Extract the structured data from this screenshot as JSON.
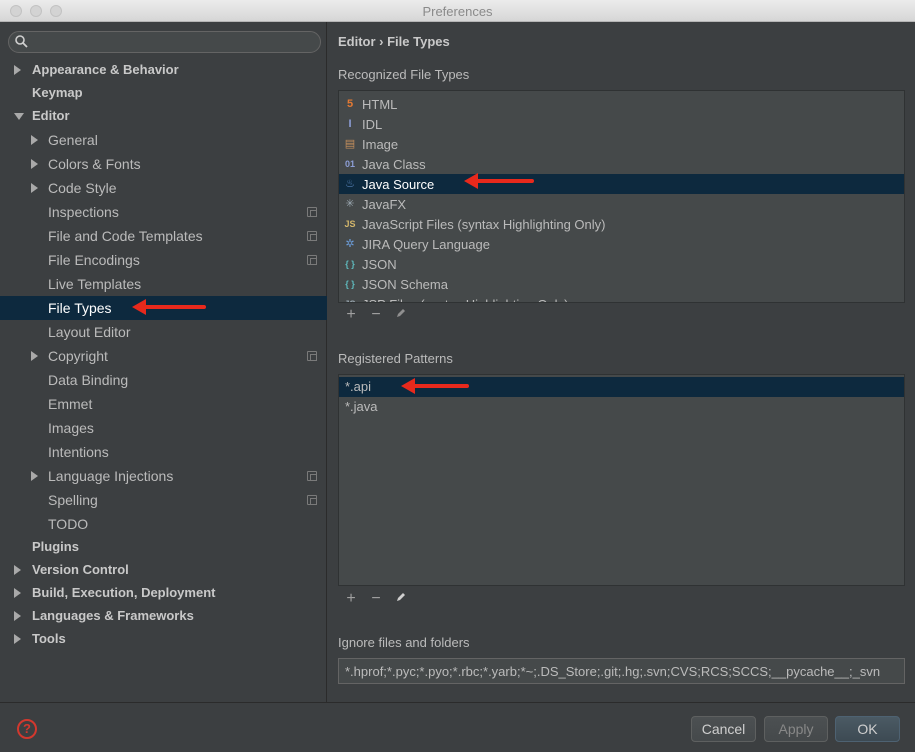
{
  "window": {
    "title": "Preferences"
  },
  "search": {
    "placeholder": ""
  },
  "sidebar": {
    "items": [
      {
        "label": "Appearance & Behavior",
        "arrow": "right",
        "bold": true
      },
      {
        "label": "Keymap",
        "arrow": "",
        "bold": true
      },
      {
        "label": "Editor",
        "arrow": "down",
        "bold": true
      },
      {
        "label": "General",
        "arrow": "right"
      },
      {
        "label": "Colors & Fonts",
        "arrow": "right"
      },
      {
        "label": "Code Style",
        "arrow": "right"
      },
      {
        "label": "Inspections",
        "copy": true
      },
      {
        "label": "File and Code Templates",
        "copy": true
      },
      {
        "label": "File Encodings",
        "copy": true
      },
      {
        "label": "Live Templates"
      },
      {
        "label": "File Types",
        "selected": true
      },
      {
        "label": "Layout Editor"
      },
      {
        "label": "Copyright",
        "arrow": "right",
        "copy": true
      },
      {
        "label": "Data Binding"
      },
      {
        "label": "Emmet"
      },
      {
        "label": "Images"
      },
      {
        "label": "Intentions"
      },
      {
        "label": "Language Injections",
        "arrow": "right",
        "copy": true
      },
      {
        "label": "Spelling",
        "copy": true
      },
      {
        "label": "TODO"
      },
      {
        "label": "Plugins",
        "bold": true
      },
      {
        "label": "Version Control",
        "arrow": "right",
        "bold": true
      },
      {
        "label": "Build, Execution, Deployment",
        "arrow": "right",
        "bold": true
      },
      {
        "label": "Languages & Frameworks",
        "arrow": "right",
        "bold": true
      },
      {
        "label": "Tools",
        "arrow": "right",
        "bold": true
      }
    ]
  },
  "main": {
    "breadcrumb": "Editor › File Types",
    "recognized_label": "Recognized File Types",
    "file_types": [
      {
        "name": "HTML",
        "icon": "html-file-icon",
        "glyph": "5",
        "color": "#e37933"
      },
      {
        "name": "IDL",
        "icon": "idl-file-icon",
        "glyph": "I",
        "color": "#8c9ed6"
      },
      {
        "name": "Image",
        "icon": "image-file-icon",
        "glyph": "▤",
        "color": "#c58f5c"
      },
      {
        "name": "Java Class",
        "icon": "java-class-file-icon",
        "glyph": "01",
        "color": "#8c9ed6"
      },
      {
        "name": "Java Source",
        "icon": "java-source-file-icon",
        "glyph": "♨",
        "color": "#5d8ac2",
        "selected": true
      },
      {
        "name": "JavaFX",
        "icon": "javafx-file-icon",
        "glyph": "✳",
        "color": "#9aa7b0"
      },
      {
        "name": "JavaScript Files (syntax Highlighting Only)",
        "icon": "javascript-file-icon",
        "glyph": "JS",
        "color": "#d3b66b"
      },
      {
        "name": "JIRA Query Language",
        "icon": "jira-file-icon",
        "glyph": "✲",
        "color": "#6b9bd6"
      },
      {
        "name": "JSON",
        "icon": "json-file-icon",
        "glyph": "{ }",
        "color": "#5fb9bd"
      },
      {
        "name": "JSON Schema",
        "icon": "json-schema-file-icon",
        "glyph": "{ }",
        "color": "#5fb9bd"
      },
      {
        "name": "JSP Files (syntax Highlighting Only)",
        "icon": "jsp-file-icon",
        "glyph": "JS",
        "color": "#9aa7b0"
      }
    ],
    "registered_label": "Registered Patterns",
    "patterns": [
      {
        "value": "*.api",
        "selected": true
      },
      {
        "value": "*.java"
      }
    ],
    "ignore_label": "Ignore files and folders",
    "ignore_value": "*.hprof;*.pyc;*.pyo;*.rbc;*.yarb;*~;.DS_Store;.git;.hg;.svn;CVS;RCS;SCCS;__pycache__;_svn"
  },
  "buttons": {
    "cancel": "Cancel",
    "apply": "Apply",
    "ok": "OK",
    "help": "?"
  },
  "colors": {
    "selection": "#0d293e",
    "annotation_arrow": "#e8291c"
  }
}
